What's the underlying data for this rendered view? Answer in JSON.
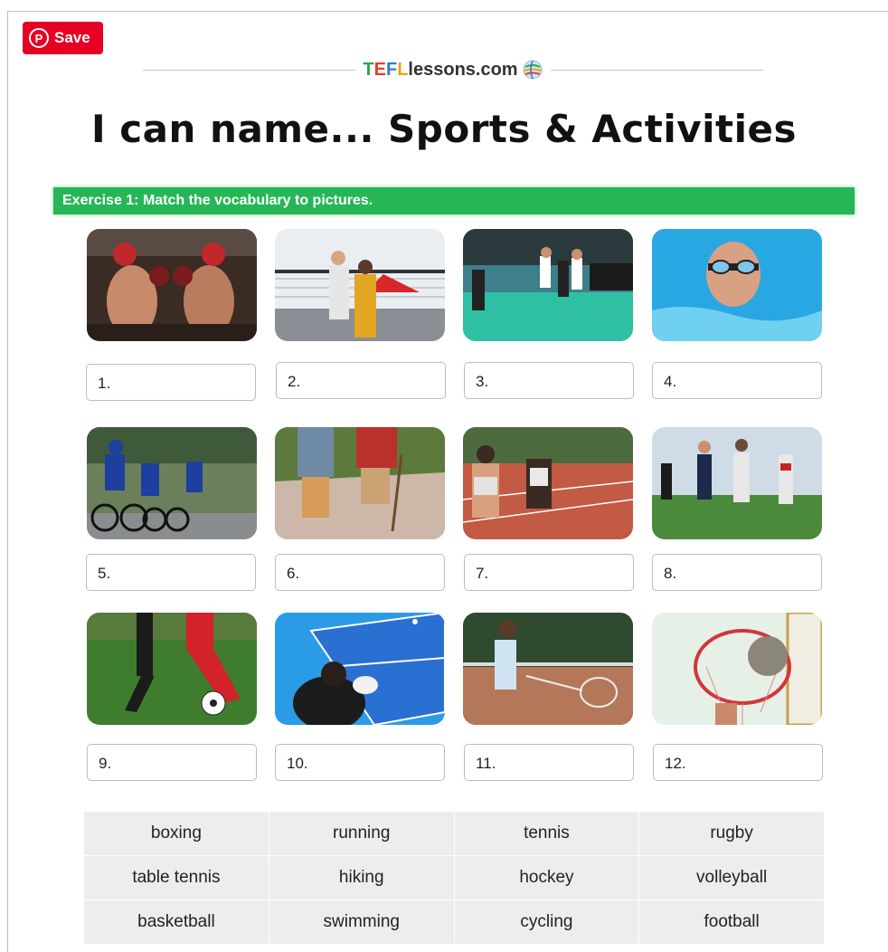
{
  "save_button": {
    "label": "Save",
    "icon": "pinterest-icon"
  },
  "brand": {
    "t": "T",
    "e": "E",
    "f": "F",
    "l": "L",
    "rest": "lessons.com",
    "icon": "globe-icon"
  },
  "title": "I can name... Sports & Activities",
  "exercise": "Exercise 1: Match the vocabulary to pictures.",
  "pictures": [
    {
      "number": "1.",
      "depicts": "boxing"
    },
    {
      "number": "2.",
      "depicts": "volleyball"
    },
    {
      "number": "3.",
      "depicts": "hockey"
    },
    {
      "number": "4.",
      "depicts": "swimming"
    },
    {
      "number": "5.",
      "depicts": "cycling"
    },
    {
      "number": "6.",
      "depicts": "hiking"
    },
    {
      "number": "7.",
      "depicts": "running"
    },
    {
      "number": "8.",
      "depicts": "rugby"
    },
    {
      "number": "9.",
      "depicts": "football"
    },
    {
      "number": "10.",
      "depicts": "table tennis"
    },
    {
      "number": "11.",
      "depicts": "tennis"
    },
    {
      "number": "12.",
      "depicts": "basketball"
    }
  ],
  "word_bank": [
    [
      "boxing",
      "running",
      "tennis",
      "rugby"
    ],
    [
      "table tennis",
      "hiking",
      "hockey",
      "volleyball"
    ],
    [
      "basketball",
      "swimming",
      "cycling",
      "football"
    ]
  ],
  "colors": {
    "save": "#e60023",
    "exercise_bar": "#27b657",
    "word_bank_bg": "#ededed"
  }
}
